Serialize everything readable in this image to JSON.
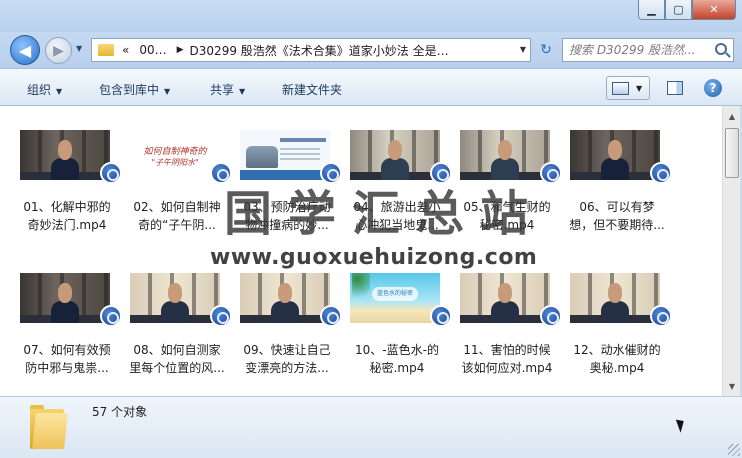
{
  "window": {
    "minimize_glyph": "▁",
    "maximize_glyph": "▢",
    "close_glyph": "✕"
  },
  "nav": {
    "back_glyph": "◀",
    "forward_glyph": "▶",
    "history_glyph": "▼",
    "breadcrumb": [
      "«",
      "00…",
      "▶",
      "D30299 殷浩然《法术合集》道家小妙法 全是…"
    ],
    "address_dropdown_glyph": "▼",
    "refresh_glyph": "↻",
    "search_placeholder": "搜索 D30299 殷浩然..."
  },
  "toolbar": {
    "organize_label": "组织",
    "include_label": "包含到库中",
    "share_label": "共享",
    "new_folder_label": "新建文件夹",
    "dropdown_glyph": "▼",
    "help_glyph": "?"
  },
  "scrollbar": {
    "up_glyph": "▲",
    "down_glyph": "▼"
  },
  "files": [
    {
      "name": "01、化解中邪的\n奇妙法门.mp4",
      "thumb": "person"
    },
    {
      "name": "02、如何自制神\n奇的“子午阴...",
      "thumb": "text",
      "thumb_text_1": "如何自制神奇的",
      "thumb_text_2": "\"子午阴阳水\""
    },
    {
      "name": "03、预防治疗动\n物冲撞病的妙...",
      "thumb": "doc"
    },
    {
      "name": "04、旅游出差小\n心冲犯当地鬼...",
      "thumb": "person-light"
    },
    {
      "name": "05、和气生财的\n秘密.mp4",
      "thumb": "person-light"
    },
    {
      "name": "06、可以有梦\n想，但不要期待...",
      "thumb": "person"
    },
    {
      "name": "07、如何有效预\n防中邪与鬼祟...",
      "thumb": "person"
    },
    {
      "name": "08、如何自测家\n里每个位置的风...",
      "thumb": "person-beige"
    },
    {
      "name": "09、快速让自己\n变漂亮的方法...",
      "thumb": "person-beige"
    },
    {
      "name": "10、-蓝色水-的\n秘密.mp4",
      "thumb": "beach",
      "thumb_text_1": "蓝色水的秘密"
    },
    {
      "name": "11、害怕的时候\n该如何应对.mp4",
      "thumb": "person-beige"
    },
    {
      "name": "12、动水催财的\n奥秘.mp4",
      "thumb": "person-beige"
    }
  ],
  "watermark": {
    "title_chars": [
      "国",
      "学",
      "汇",
      "总",
      "站"
    ],
    "url": "www.guoxuehuizong.com"
  },
  "details": {
    "count_label": "57 个对象"
  }
}
